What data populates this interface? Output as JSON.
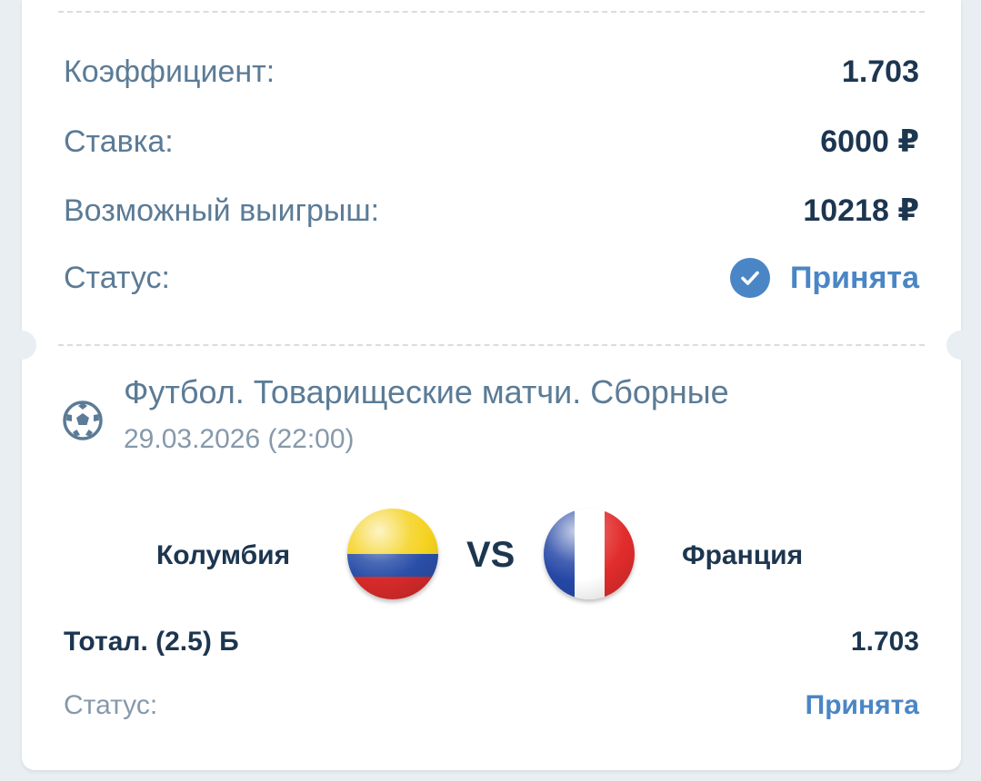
{
  "summary": {
    "coefficient_label": "Коэффициент:",
    "coefficient_value": "1.703",
    "stake_label": "Ставка:",
    "stake_value": "6000 ₽",
    "win_label": "Возможный выигрыш:",
    "win_value": "10218 ₽",
    "status_label": "Статус:",
    "status_value": "Принята"
  },
  "event": {
    "icon": "soccer-ball-icon",
    "title": "Футбол. Товарищеские матчи. Сборные",
    "datetime": "29.03.2026 (22:00)",
    "home_team": "Колумбия",
    "away_team": "Франция",
    "vs": "VS"
  },
  "selection": {
    "market": "Тотал. (2.5) Б",
    "odds": "1.703",
    "status_label": "Статус:",
    "status_value": "Принята"
  },
  "colors": {
    "accent": "#4a86c5",
    "text_dark": "#1d3650",
    "text_muted": "#5b7b96",
    "background": "#e9eef3"
  }
}
